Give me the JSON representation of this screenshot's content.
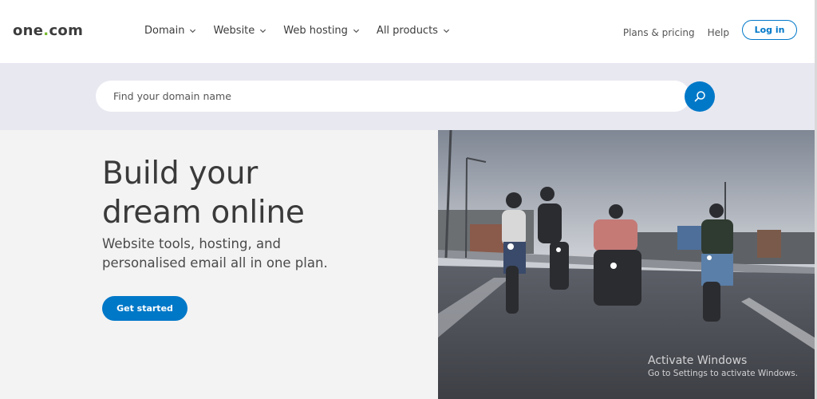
{
  "brand": {
    "logo_prefix": "one",
    "logo_dot": ".",
    "logo_suffix": "com",
    "accent": "#0078c8",
    "dot_color": "#76b82a"
  },
  "nav": {
    "items": [
      {
        "label": "Domain",
        "icon": "chevron-down-icon"
      },
      {
        "label": "Website",
        "icon": "chevron-down-icon"
      },
      {
        "label": "Web hosting",
        "icon": "chevron-down-icon"
      },
      {
        "label": "All products",
        "icon": "chevron-down-icon"
      }
    ],
    "plans_pricing": "Plans & pricing",
    "help": "Help",
    "login": "Log in"
  },
  "search": {
    "placeholder": "Find your domain name",
    "icon": "search-icon"
  },
  "hero": {
    "title_line1": "Build your",
    "title_line2": "dream online",
    "subtitle_line1": "Website tools, hosting, and",
    "subtitle_line2": "personalised email all in one plan.",
    "cta": "Get started",
    "image": "motorcyclists riding on a bridge"
  },
  "os_watermark": {
    "line1": "Activate Windows",
    "line2": "Go to Settings to activate Windows."
  }
}
